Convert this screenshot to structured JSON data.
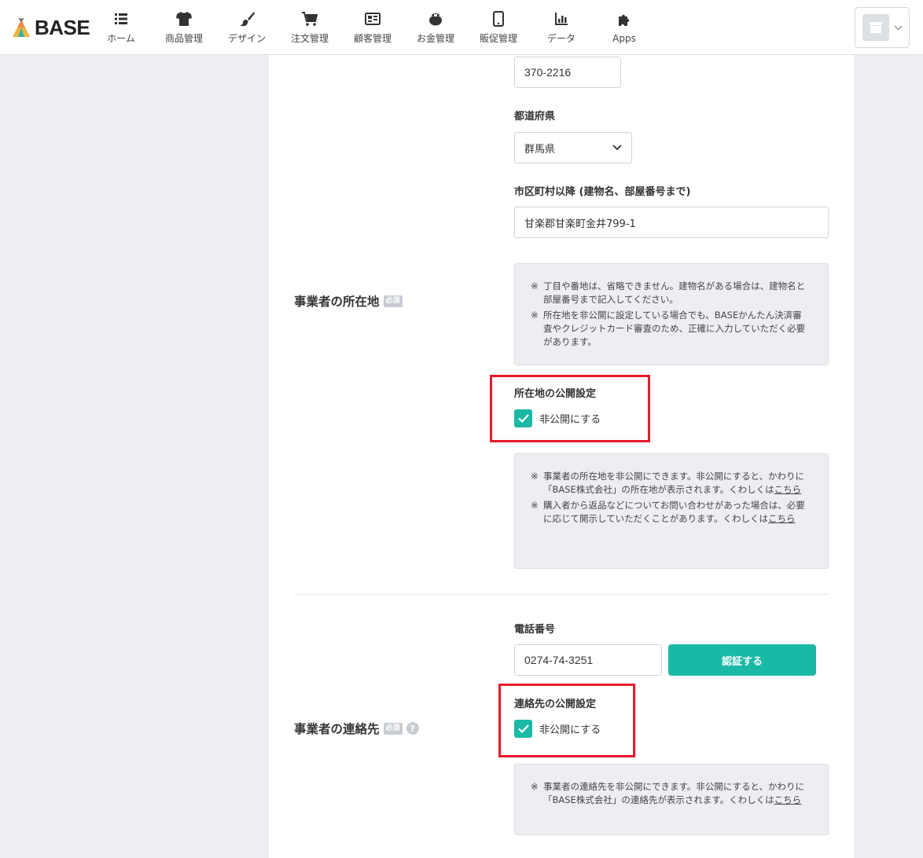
{
  "header": {
    "logo_text": "BASE",
    "nav": [
      {
        "label": "ホーム",
        "icon": "home-list-icon"
      },
      {
        "label": "商品管理",
        "icon": "tshirt-icon"
      },
      {
        "label": "デザイン",
        "icon": "paintbrush-icon"
      },
      {
        "label": "注文管理",
        "icon": "cart-icon"
      },
      {
        "label": "顧客管理",
        "icon": "id-card-icon"
      },
      {
        "label": "お金管理",
        "icon": "wallet-icon"
      },
      {
        "label": "販促管理",
        "icon": "smartphone-icon"
      },
      {
        "label": "データ",
        "icon": "bar-chart-icon"
      },
      {
        "label": "Apps",
        "icon": "puzzle-icon"
      }
    ]
  },
  "address": {
    "postal_code_value": "370-2216",
    "prefecture_label": "都道府県",
    "prefecture_value": "群馬県",
    "city_label": "市区町村以降 (建物名、部屋番号まで)",
    "city_value": "甘楽郡甘楽町金井799-1",
    "section_label": "事業者の所在地",
    "required_badge": "必須",
    "note_mark": "※",
    "notes": [
      "丁目や番地は、省略できません。建物名がある場合は、建物名と部屋番号まで記入してください。",
      "所在地を非公開に設定している場合でも、BASEかんたん決済審査やクレジットカード審査のため、正確に入力していただく必要があります。"
    ],
    "visibility_label": "所在地の公開設定",
    "private_checkbox_label": "非公開にする",
    "private_checked": true,
    "visibility_notes": [
      {
        "text": "事業者の所在地を非公開にできます。非公開にすると、かわりに「BASE株式会社」の所在地が表示されます。くわしくは",
        "link": "こちら"
      },
      {
        "text": "購入者から返品などについてお問い合わせがあった場合は、必要に応じて開示していただくことがあります。くわしくは",
        "link": "こちら"
      }
    ]
  },
  "contact": {
    "section_label": "事業者の連絡先",
    "required_badge": "必須",
    "help_glyph": "?",
    "phone_label": "電話番号",
    "phone_value": "0274-74-3251",
    "verify_button": "認証する",
    "visibility_label": "連絡先の公開設定",
    "private_checkbox_label": "非公開にする",
    "private_checked": true,
    "visibility_note": {
      "text": "事業者の連絡先を非公開にできます。非公開にすると、かわりに「BASE株式会社」の連絡先が表示されます。くわしくは",
      "link": "こちら"
    }
  },
  "colors": {
    "accent": "#1ab9a5",
    "highlight": "#e8192b",
    "background": "#eceef2"
  }
}
